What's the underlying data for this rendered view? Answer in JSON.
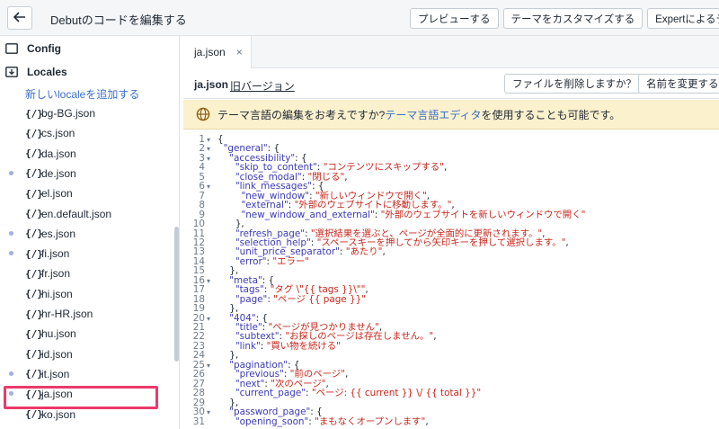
{
  "header": {
    "title": "Debutのコードを編集する",
    "actions": [
      "プレビューする",
      "テーマをカスタマイズする",
      "Expertによるテーマ"
    ]
  },
  "sidebar": {
    "folders": [
      {
        "label": "Config",
        "expanded": false
      },
      {
        "label": "Locales",
        "expanded": true
      }
    ],
    "add_locale": "新しいlocaleを追加する",
    "files": [
      {
        "name": "bg-BG.json",
        "icon": "{/}",
        "dot": false
      },
      {
        "name": "cs.json",
        "icon": "{/}",
        "dot": false
      },
      {
        "name": "da.json",
        "icon": "{/}",
        "dot": false
      },
      {
        "name": "de.json",
        "icon": "{/}",
        "dot": true
      },
      {
        "name": "el.json",
        "icon": "{/}",
        "dot": false
      },
      {
        "name": "en.default.json",
        "icon": "{/}",
        "dot": false
      },
      {
        "name": "es.json",
        "icon": "{/}",
        "dot": true
      },
      {
        "name": "fi.json",
        "icon": "{/}",
        "dot": true
      },
      {
        "name": "fr.json",
        "icon": "{/}",
        "dot": false
      },
      {
        "name": "hi.json",
        "icon": "{/}",
        "dot": false
      },
      {
        "name": "hr-HR.json",
        "icon": "{/}",
        "dot": false
      },
      {
        "name": "hu.json",
        "icon": "{/}",
        "dot": false
      },
      {
        "name": "id.json",
        "icon": "{/}",
        "dot": false
      },
      {
        "name": "it.json",
        "icon": "{/}",
        "dot": true
      },
      {
        "name": "ja.json",
        "icon": "{/}",
        "dot": true
      },
      {
        "name": "ko.json",
        "icon": "{/}",
        "dot": false
      }
    ]
  },
  "editor": {
    "tab_label": "ja.json",
    "tab_close": "×",
    "file_name": "ja.json",
    "old_version": "旧バージョン",
    "delete_button": "ファイルを削除しますか？",
    "rename_button": "名前を変更する",
    "banner": {
      "text_before": "テーマ言語の編集をお考えですか?",
      "link": "テーマ言語エディタ",
      "text_after": "を使用することも可能です。"
    },
    "lines": [
      {
        "n": "1",
        "fold": true,
        "parts": [
          [
            "p",
            "{"
          ]
        ]
      },
      {
        "n": "2",
        "fold": true,
        "parts": [
          [
            "p",
            "  "
          ],
          [
            "k",
            "\"general\""
          ],
          [
            "p",
            ": {"
          ]
        ]
      },
      {
        "n": "3",
        "fold": true,
        "parts": [
          [
            "p",
            "    "
          ],
          [
            "k",
            "\"accessibility\""
          ],
          [
            "p",
            ": {"
          ]
        ]
      },
      {
        "n": "4",
        "fold": false,
        "parts": [
          [
            "p",
            "      "
          ],
          [
            "k",
            "\"skip_to_content\""
          ],
          [
            "p",
            ": "
          ],
          [
            "s",
            "\"コンテンツにスキップする\""
          ],
          [
            "p",
            ","
          ]
        ]
      },
      {
        "n": "5",
        "fold": false,
        "parts": [
          [
            "p",
            "      "
          ],
          [
            "k",
            "\"close_modal\""
          ],
          [
            "p",
            ": "
          ],
          [
            "s",
            "\"閉じる\""
          ],
          [
            "p",
            ","
          ]
        ]
      },
      {
        "n": "6",
        "fold": true,
        "parts": [
          [
            "p",
            "      "
          ],
          [
            "k",
            "\"link_messages\""
          ],
          [
            "p",
            ": {"
          ]
        ]
      },
      {
        "n": "7",
        "fold": false,
        "parts": [
          [
            "p",
            "        "
          ],
          [
            "k",
            "\"new_window\""
          ],
          [
            "p",
            ": "
          ],
          [
            "s",
            "\"新しいウィンドウで開く\""
          ],
          [
            "p",
            ","
          ]
        ]
      },
      {
        "n": "8",
        "fold": false,
        "parts": [
          [
            "p",
            "        "
          ],
          [
            "k",
            "\"external\""
          ],
          [
            "p",
            ": "
          ],
          [
            "s",
            "\"外部のウェブサイトに移動します。\""
          ],
          [
            "p",
            ","
          ]
        ]
      },
      {
        "n": "9",
        "fold": false,
        "parts": [
          [
            "p",
            "        "
          ],
          [
            "k",
            "\"new_window_and_external\""
          ],
          [
            "p",
            ": "
          ],
          [
            "s",
            "\"外部のウェブサイトを新しいウィンドウで開く\""
          ]
        ]
      },
      {
        "n": "10",
        "fold": false,
        "parts": [
          [
            "p",
            "      },"
          ]
        ]
      },
      {
        "n": "11",
        "fold": false,
        "parts": [
          [
            "p",
            "      "
          ],
          [
            "k",
            "\"refresh_page\""
          ],
          [
            "p",
            ": "
          ],
          [
            "s",
            "\"選択結果を選ぶと、ページが全面的に更新されます。\""
          ],
          [
            "p",
            ","
          ]
        ]
      },
      {
        "n": "12",
        "fold": false,
        "parts": [
          [
            "p",
            "      "
          ],
          [
            "k",
            "\"selection_help\""
          ],
          [
            "p",
            ": "
          ],
          [
            "s",
            "\"スペースキーを押してから矢印キーを押して選択します。\""
          ],
          [
            "p",
            ","
          ]
        ]
      },
      {
        "n": "13",
        "fold": false,
        "parts": [
          [
            "p",
            "      "
          ],
          [
            "k",
            "\"unit_price_separator\""
          ],
          [
            "p",
            ": "
          ],
          [
            "s",
            "\"あたり\""
          ],
          [
            "p",
            ","
          ]
        ]
      },
      {
        "n": "14",
        "fold": false,
        "parts": [
          [
            "p",
            "      "
          ],
          [
            "k",
            "\"error\""
          ],
          [
            "p",
            ": "
          ],
          [
            "s",
            "\"エラー\""
          ]
        ]
      },
      {
        "n": "15",
        "fold": false,
        "parts": [
          [
            "p",
            "    },"
          ]
        ]
      },
      {
        "n": "16",
        "fold": true,
        "parts": [
          [
            "p",
            "    "
          ],
          [
            "k",
            "\"meta\""
          ],
          [
            "p",
            ": {"
          ]
        ]
      },
      {
        "n": "17",
        "fold": false,
        "parts": [
          [
            "p",
            "      "
          ],
          [
            "k",
            "\"tags\""
          ],
          [
            "p",
            ": "
          ],
          [
            "s",
            "\"タグ \\\"{{ tags }}\\\"\""
          ],
          [
            "p",
            ","
          ]
        ]
      },
      {
        "n": "18",
        "fold": false,
        "parts": [
          [
            "p",
            "      "
          ],
          [
            "k",
            "\"page\""
          ],
          [
            "p",
            ": "
          ],
          [
            "s",
            "\"ページ {{ page }}\""
          ]
        ]
      },
      {
        "n": "19",
        "fold": false,
        "parts": [
          [
            "p",
            "    },"
          ]
        ]
      },
      {
        "n": "20",
        "fold": true,
        "parts": [
          [
            "p",
            "    "
          ],
          [
            "k",
            "\"404\""
          ],
          [
            "p",
            ": {"
          ]
        ]
      },
      {
        "n": "21",
        "fold": false,
        "parts": [
          [
            "p",
            "      "
          ],
          [
            "k",
            "\"title\""
          ],
          [
            "p",
            ": "
          ],
          [
            "s",
            "\"ページが見つかりません\""
          ],
          [
            "p",
            ","
          ]
        ]
      },
      {
        "n": "22",
        "fold": false,
        "parts": [
          [
            "p",
            "      "
          ],
          [
            "k",
            "\"subtext\""
          ],
          [
            "p",
            ": "
          ],
          [
            "s",
            "\"お探しのページは存在しません。\""
          ],
          [
            "p",
            ","
          ]
        ]
      },
      {
        "n": "23",
        "fold": false,
        "parts": [
          [
            "p",
            "      "
          ],
          [
            "k",
            "\"link\""
          ],
          [
            "p",
            ": "
          ],
          [
            "s",
            "\"買い物を続ける\""
          ]
        ]
      },
      {
        "n": "24",
        "fold": false,
        "parts": [
          [
            "p",
            "    },"
          ]
        ]
      },
      {
        "n": "25",
        "fold": true,
        "parts": [
          [
            "p",
            "    "
          ],
          [
            "k",
            "\"pagination\""
          ],
          [
            "p",
            ": {"
          ]
        ]
      },
      {
        "n": "26",
        "fold": false,
        "parts": [
          [
            "p",
            "      "
          ],
          [
            "k",
            "\"previous\""
          ],
          [
            "p",
            ": "
          ],
          [
            "s",
            "\"前のページ\""
          ],
          [
            "p",
            ","
          ]
        ]
      },
      {
        "n": "27",
        "fold": false,
        "parts": [
          [
            "p",
            "      "
          ],
          [
            "k",
            "\"next\""
          ],
          [
            "p",
            ": "
          ],
          [
            "s",
            "\"次のページ\""
          ],
          [
            "p",
            ","
          ]
        ]
      },
      {
        "n": "28",
        "fold": false,
        "parts": [
          [
            "p",
            "      "
          ],
          [
            "k",
            "\"current_page\""
          ],
          [
            "p",
            ": "
          ],
          [
            "s",
            "\"ページ: {{ current }} \\/ {{ total }}\""
          ]
        ]
      },
      {
        "n": "29",
        "fold": false,
        "parts": [
          [
            "p",
            "    },"
          ]
        ]
      },
      {
        "n": "30",
        "fold": true,
        "parts": [
          [
            "p",
            "    "
          ],
          [
            "k",
            "\"password_page\""
          ],
          [
            "p",
            ": {"
          ]
        ]
      },
      {
        "n": "31",
        "fold": false,
        "parts": [
          [
            "p",
            "      "
          ],
          [
            "k",
            "\"opening_soon\""
          ],
          [
            "p",
            ": "
          ],
          [
            "s",
            "\"まもなくオープンします\""
          ],
          [
            "p",
            ","
          ]
        ]
      }
    ]
  },
  "colors": {
    "json_key": "#3b39b3",
    "json_string": "#c7271c",
    "link": "#3a6fc9",
    "highlight_box": "#ea3a6b",
    "banner_bg": "#fcf1cd",
    "modified_dot": "#9fb2d9"
  }
}
